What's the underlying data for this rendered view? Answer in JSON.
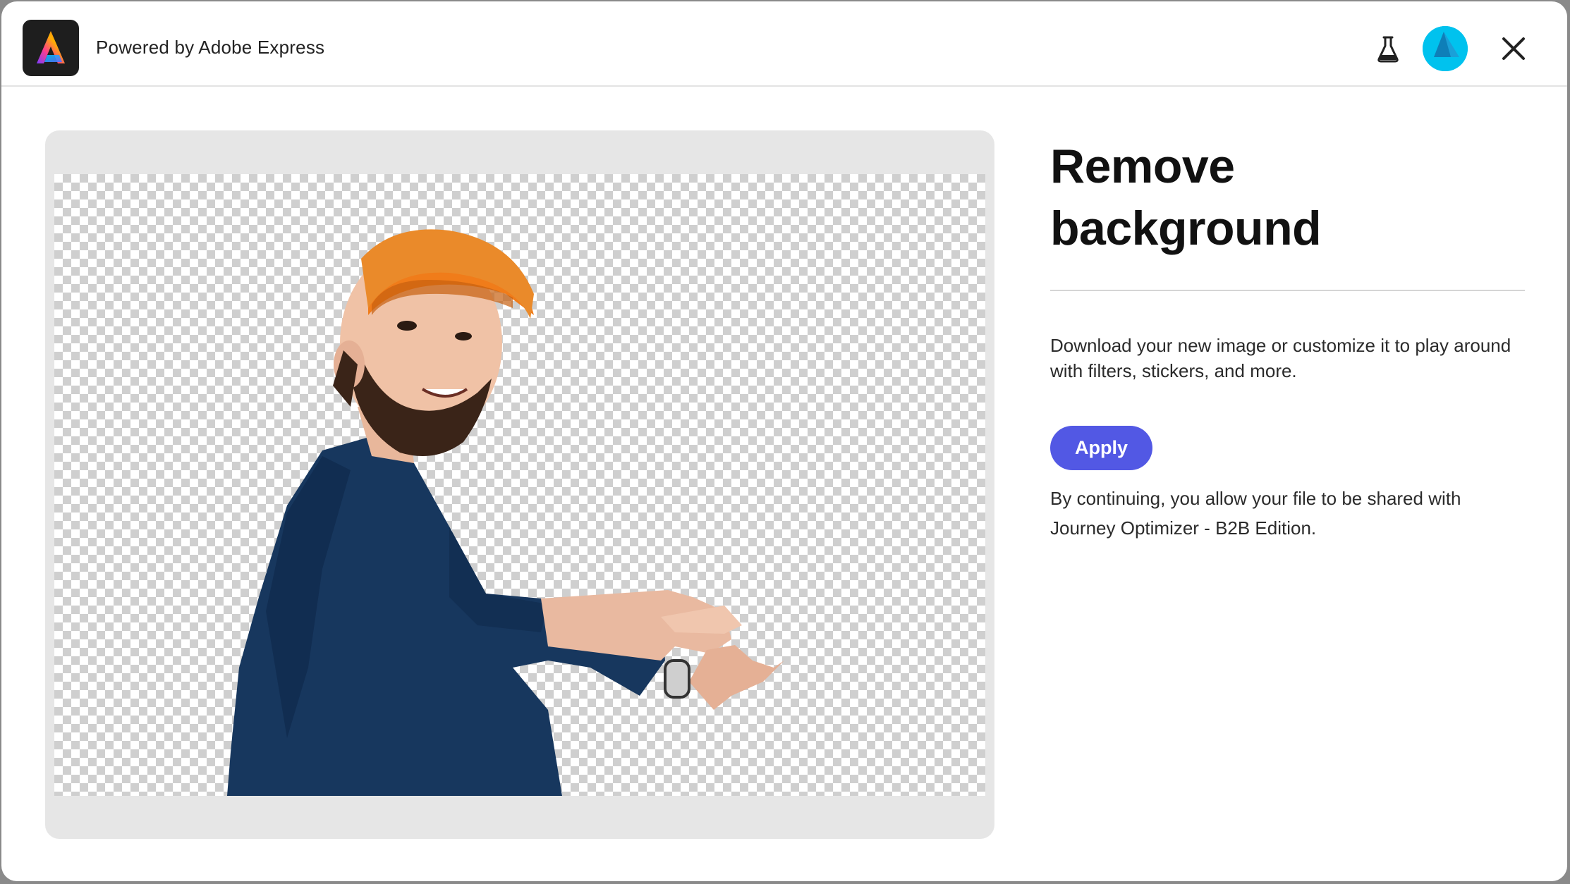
{
  "header": {
    "powered_by": "Powered by Adobe Express",
    "logo_icon": "adobe-express-logo-icon",
    "labs_icon": "beaker-icon",
    "avatar_icon": "user-avatar",
    "close_icon": "close-icon"
  },
  "preview": {
    "image_description_icon": "background-removed-photo"
  },
  "panel": {
    "title": "Remove background",
    "description": "Download your new image or customize it to play around with filters, stickers, and more.",
    "apply_label": "Apply",
    "consent": "By continuing, you allow your file to be shared with Journey Optimizer - B2B Edition."
  },
  "colors": {
    "accent": "#5258e4",
    "avatar": "#00c2ee",
    "logo_bg": "#1e1e1e"
  }
}
